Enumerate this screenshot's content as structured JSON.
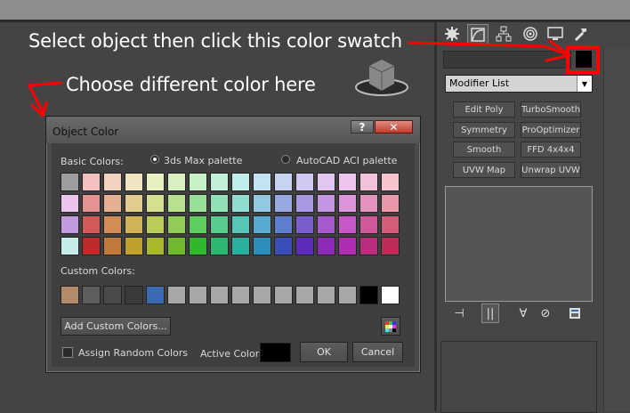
{
  "annotations": {
    "swatch_hint": "Select object then click this color swatch",
    "color_hint": "Choose different color here"
  },
  "command_panel": {
    "tabs": [
      "create-tab",
      "modify-tab",
      "hierarchy-tab",
      "motion-tab",
      "display-tab",
      "utilities-tab"
    ],
    "object_name_value": "",
    "modifier_list_label": "Modifier List",
    "modifier_buttons": [
      [
        "Edit Poly",
        "TurboSmooth"
      ],
      [
        "Symmetry",
        "ProOptimizer"
      ],
      [
        "Smooth",
        "FFD 4x4x4"
      ],
      [
        "UVW Map",
        "Unwrap UVW"
      ]
    ],
    "object_color": "#000000"
  },
  "dialog": {
    "title": "Object Color",
    "help_label": "?",
    "close_label": "✕",
    "basic_colors_label": "Basic Colors:",
    "palette_options": [
      {
        "label": "3ds Max palette",
        "selected": true
      },
      {
        "label": "AutoCAD ACI palette",
        "selected": false
      }
    ],
    "basic_colors": [
      [
        "#9e9e9e",
        "#f3c0c0",
        "#f3d2bf",
        "#f1e4c0",
        "#e6f0c0",
        "#d8f0c0",
        "#c6f0c6",
        "#c2f0d8",
        "#c0eee8",
        "#c2e4f2",
        "#c6d4f2",
        "#d0c8f2",
        "#e2c6f2",
        "#eec4ec",
        "#f2c2da",
        "#f7c3cd"
      ],
      [
        "#ecc3ec",
        "#e59292",
        "#e5b08f",
        "#e3cc8f",
        "#d4e090",
        "#b8e090",
        "#98e098",
        "#92e0b6",
        "#90dcd0",
        "#92c8e2",
        "#98a8e2",
        "#a898e2",
        "#c496e2",
        "#dc94dc",
        "#e292bc",
        "#e898a8"
      ],
      [
        "#c19bdd",
        "#d45a5a",
        "#d48c57",
        "#d2b257",
        "#bccc58",
        "#92cc58",
        "#5ecc5e",
        "#58cc8e",
        "#56c6b6",
        "#58aace",
        "#5e7ece",
        "#7a5ece",
        "#a65ace",
        "#c858c8",
        "#ce5898",
        "#d45c78"
      ],
      [
        "#c6ecea",
        "#c02a2a",
        "#c27a3c",
        "#c0a02c",
        "#a8b82c",
        "#70b82c",
        "#2eb82e",
        "#2cb870",
        "#2ab09c",
        "#2c8eba",
        "#3a4eba",
        "#5e2cba",
        "#8e2aba",
        "#b02cb0",
        "#ba2c7c",
        "#c02c5a"
      ]
    ],
    "custom_colors_label": "Custom Colors:",
    "custom_colors": [
      "#b38a6a",
      "#5e5e5e",
      "#4a4a4a",
      "#3a3a3a",
      "#3a6bb2",
      "#a8a8a8",
      "#a8a8a8",
      "#a8a8a8",
      "#a8a8a8",
      "#a8a8a8",
      "#a8a8a8",
      "#a8a8a8",
      "#a8a8a8",
      "#a8a8a8",
      "#000000",
      "#ffffff"
    ],
    "add_custom_label": "Add Custom Colors...",
    "assign_random_label": "Assign Random Colors",
    "assign_random_checked": false,
    "active_color_label": "Active Color:",
    "active_color": "#000000",
    "ok_label": "OK",
    "cancel_label": "Cancel"
  }
}
